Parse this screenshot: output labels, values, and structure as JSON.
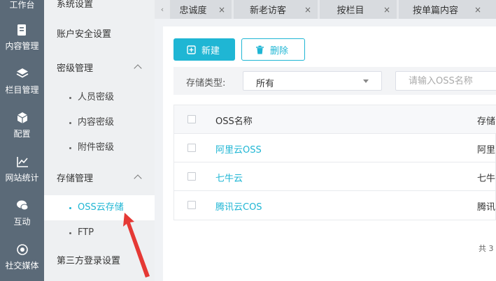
{
  "rail": {
    "workbench": "工作台",
    "items": [
      {
        "label": "内容管理",
        "icon": "document-edit-icon"
      },
      {
        "label": "栏目管理",
        "icon": "layers-icon"
      },
      {
        "label": "配置",
        "icon": "cube-icon"
      },
      {
        "label": "网站统计",
        "icon": "line-chart-icon"
      },
      {
        "label": "互动",
        "icon": "chat-bubbles-icon"
      },
      {
        "label": "社交媒体",
        "icon": "target-icon"
      }
    ]
  },
  "menu": {
    "system_settings": "系统设置",
    "account_security": "账户安全设置",
    "security_level": "密级管理",
    "security_subs": [
      "人员密级",
      "内容密级",
      "附件密级"
    ],
    "storage": "存储管理",
    "storage_subs": [
      "OSS云存储",
      "FTP"
    ],
    "third_party_login": "第三方登录设置"
  },
  "tabs": [
    {
      "label": "忠诚度",
      "close": "×"
    },
    {
      "label": "新老访客",
      "close": "×"
    },
    {
      "label": "按栏目",
      "close": "×"
    },
    {
      "label": "按单篇内容",
      "close": "×"
    }
  ],
  "tab_nav": "‹",
  "toolbar": {
    "new_label": "新建",
    "delete_label": "删除"
  },
  "filter": {
    "storage_type_label": "存储类型:",
    "storage_type_value": "所有",
    "search_placeholder": "请输入OSS名称"
  },
  "table": {
    "headers": {
      "name": "OSS名称",
      "type": "存储"
    },
    "rows": [
      {
        "name": "阿里云OSS",
        "type": "阿里"
      },
      {
        "name": "七牛云",
        "type": "七牛"
      },
      {
        "name": "腾讯云COS",
        "type": "腾讯"
      }
    ]
  },
  "pagination": {
    "total_text": "共 3"
  },
  "colors": {
    "accent": "#1fb6d4",
    "rail_bg": "#5b6a78",
    "annotation_arrow": "#e53935"
  }
}
